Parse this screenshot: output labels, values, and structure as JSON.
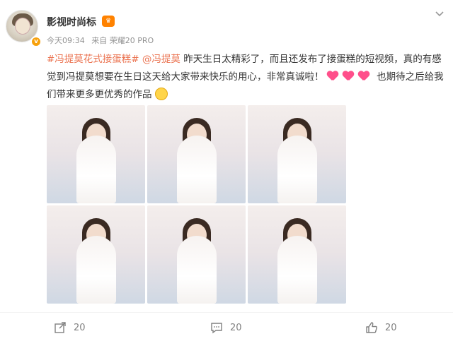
{
  "user": {
    "name": "影视时尚标",
    "time": "今天09:34",
    "source": "来自 荣耀20 PRO"
  },
  "post": {
    "hashtag": "#冯提莫花式接蛋糕#",
    "mention": "@冯提莫",
    "text_part1": "昨天生日太精彩了，而且还发布了接蛋糕的短视频，真的有感觉到冯提莫想要在生日这天给大家带来快乐的用心，非常真诚啦！",
    "text_part2": "也期待之后给我们带来更多更优秀的作品"
  },
  "images": [
    "photo-1",
    "photo-2",
    "photo-3",
    "photo-4",
    "photo-5",
    "photo-6"
  ],
  "actions": {
    "repost_count": "20",
    "comment_count": "20",
    "like_count": "20"
  },
  "colors": {
    "link": "#eb7350",
    "meta": "#939393",
    "action": "#808080"
  },
  "icons": {
    "repost": "share-arrow-icon",
    "comment": "comment-bubble-icon",
    "like": "thumbs-up-icon",
    "more": "chevron-down-icon"
  }
}
